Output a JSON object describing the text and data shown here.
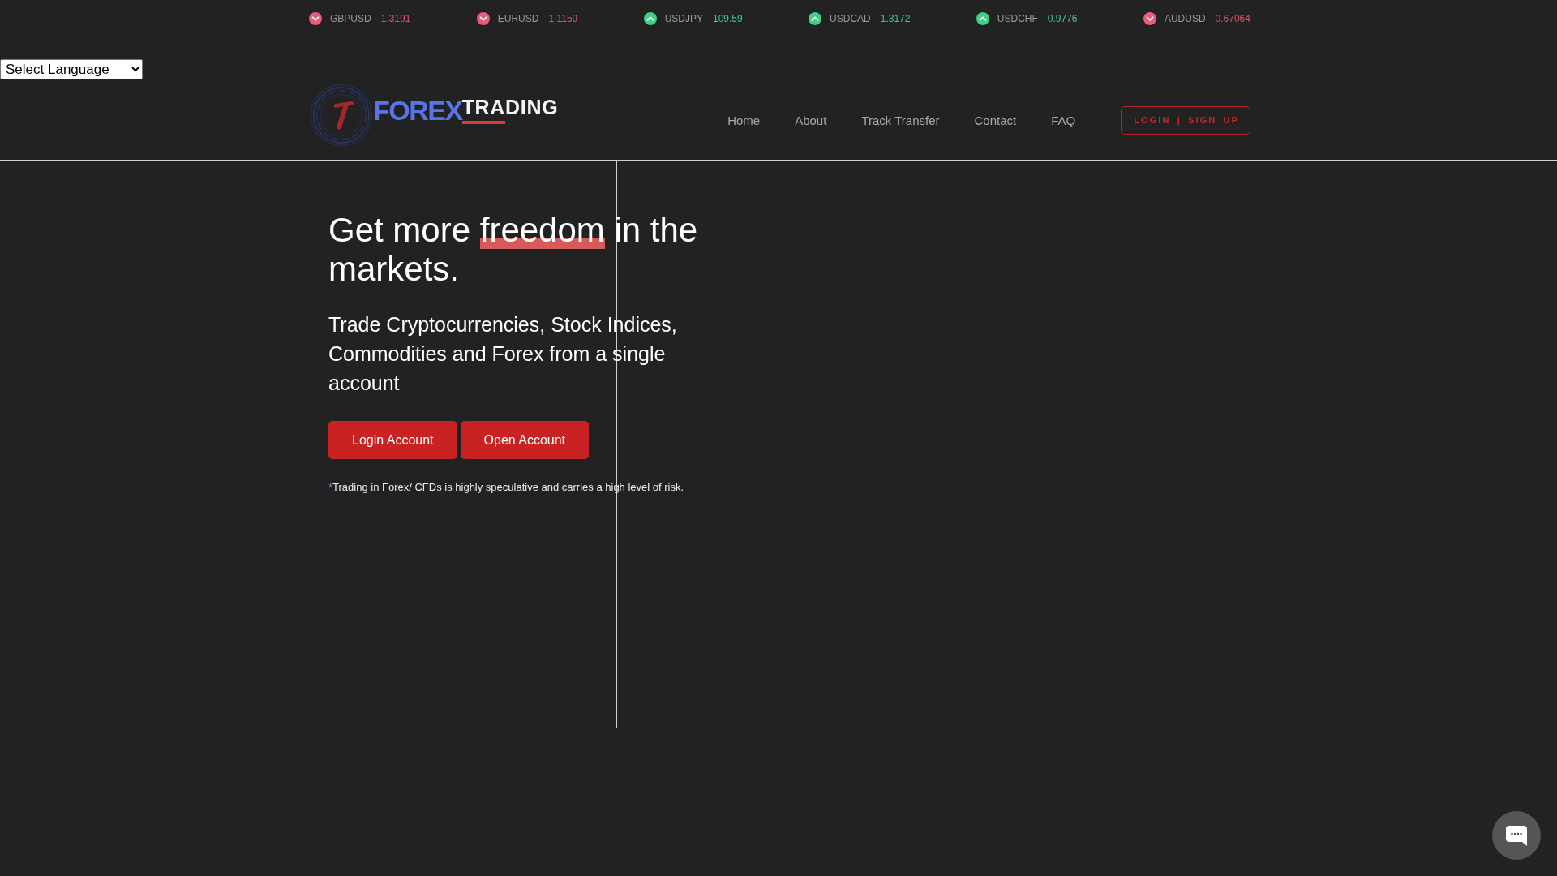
{
  "ticker": [
    {
      "pair": "GBPUSD",
      "price": "1.3191",
      "rising": false
    },
    {
      "pair": "EURUSD",
      "price": "1.1159",
      "rising": false
    },
    {
      "pair": "USDJPY",
      "price": "109.59",
      "rising": true
    },
    {
      "pair": "USDCAD",
      "price": "1.3172",
      "rising": true
    },
    {
      "pair": "USDCHF",
      "price": "0.9776",
      "rising": true
    },
    {
      "pair": "AUDUSD",
      "price": "0.67064",
      "rising": false
    }
  ],
  "language_select": {
    "value": "Select Language"
  },
  "logo": {
    "word_1": "FOREX",
    "word_2": "TRADING"
  },
  "nav": [
    "Home",
    "About",
    "Track Transfer",
    "Contact",
    "FAQ"
  ],
  "auth_button": "LOGIN | SIGN UP",
  "hero": {
    "headline": {
      "before": "Get more ",
      "highlight": "freedom",
      "after": " in the markets."
    },
    "subtitle": "Trade Cryptocurrencies, Stock Indices, Commodities and Forex from a single account",
    "buttons": [
      "Login Account",
      "Open Account"
    ],
    "disclaimer": {
      "mark": "*",
      "text": "Trading in Forex/ CFDs is highly speculative and carries a high level of risk."
    }
  }
}
